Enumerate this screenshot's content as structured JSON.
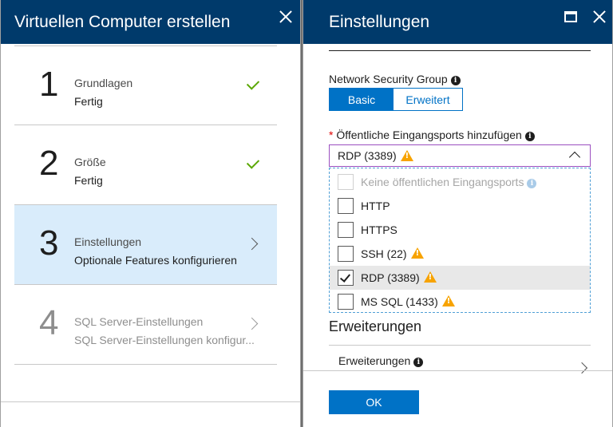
{
  "left_blade": {
    "title": "Virtuellen Computer erstellen",
    "steps": [
      {
        "number": "1",
        "title": "Grundlagen",
        "subtitle": "Fertig",
        "state": "done"
      },
      {
        "number": "2",
        "title": "Größe",
        "subtitle": "Fertig",
        "state": "done"
      },
      {
        "number": "3",
        "title": "Einstellungen",
        "subtitle": "Optionale Features konfigurieren",
        "state": "active"
      },
      {
        "number": "4",
        "title": "SQL Server-Einstellungen",
        "subtitle": "SQL Server-Einstellungen konfigur...",
        "state": "disabled"
      }
    ]
  },
  "right_blade": {
    "title": "Einstellungen",
    "nsg_label": "Network Security Group",
    "nsg_options": {
      "basic": "Basic",
      "advanced": "Erweitert",
      "selected": "Basic"
    },
    "ports_required_marker": "*",
    "ports_label": "Öffentliche Eingangsports hinzufügen",
    "ports_selected_value": "RDP (3389)",
    "ports_options": [
      {
        "label": "Keine öffentlichen Eingangsports",
        "checked": false,
        "disabled": true,
        "icon": "info-icon"
      },
      {
        "label": "HTTP",
        "checked": false,
        "disabled": false,
        "icon": ""
      },
      {
        "label": "HTTPS",
        "checked": false,
        "disabled": false,
        "icon": ""
      },
      {
        "label": "SSH (22)",
        "checked": false,
        "disabled": false,
        "icon": "warning-icon"
      },
      {
        "label": "RDP (3389)",
        "checked": true,
        "disabled": false,
        "icon": "warning-icon"
      },
      {
        "label": "MS SQL (1433)",
        "checked": false,
        "disabled": false,
        "icon": "warning-icon"
      }
    ],
    "extensions_section": "Erweiterungen",
    "extensions_label": "Erweiterungen",
    "ok_label": "OK"
  },
  "colors": {
    "header": "#003a6b",
    "accent": "#0072c6",
    "active_step": "#d9ecfb",
    "check": "#5aa702",
    "warning": "#f7a300"
  }
}
